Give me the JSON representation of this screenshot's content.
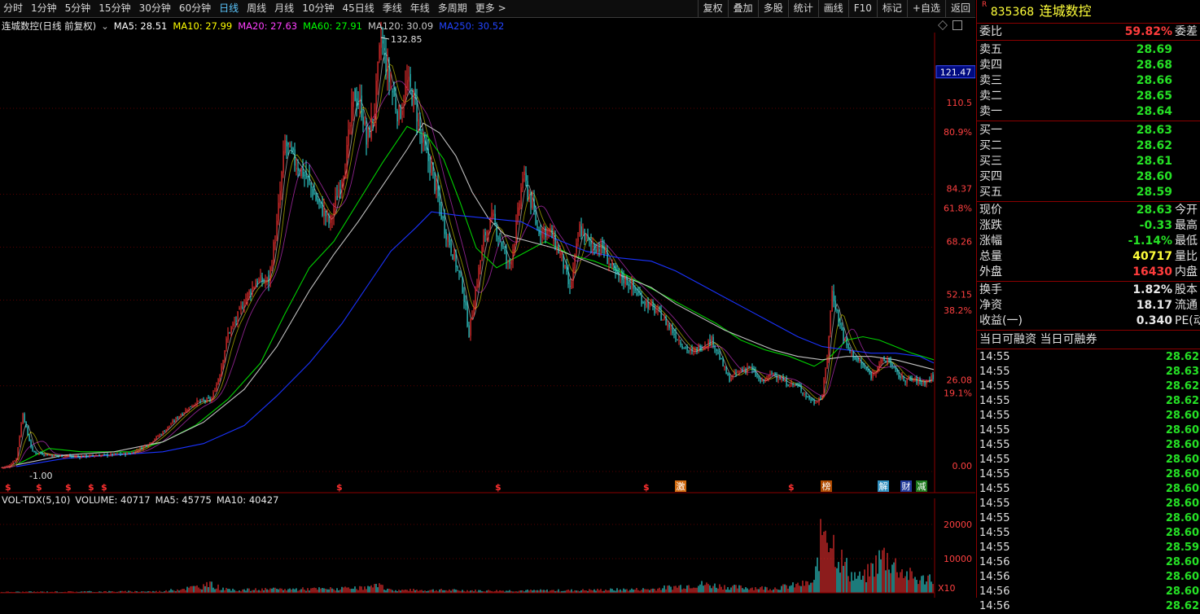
{
  "toolbar": {
    "periods": [
      "分时",
      "1分钟",
      "5分钟",
      "15分钟",
      "30分钟",
      "60分钟",
      "日线",
      "周线",
      "月线",
      "10分钟",
      "45日线",
      "季线",
      "年线",
      "多周期"
    ],
    "active_period": "日线",
    "more": "更多",
    "tools": [
      "复权",
      "叠加",
      "多股",
      "统计",
      "画线",
      "F10",
      "标记",
      "+自选",
      "返回"
    ]
  },
  "chart_data": {
    "type": "candlestick",
    "title": "连城数控(日线 前复权)",
    "indicators": [
      {
        "name": "MA5",
        "value": "28.51",
        "color": "#ffffff"
      },
      {
        "name": "MA10",
        "value": "27.99",
        "color": "#ffff00"
      },
      {
        "name": "MA20",
        "value": "27.63",
        "color": "#ff40ff"
      },
      {
        "name": "MA60",
        "value": "27.91",
        "color": "#00ff00"
      },
      {
        "name": "MA120",
        "value": "30.09",
        "color": "#c8c8c8"
      },
      {
        "name": "MA250",
        "value": "30.52",
        "color": "#2244ff"
      }
    ],
    "y_axis": {
      "ticks": [
        {
          "label": "110.5",
          "value": 110.5
        },
        {
          "label": "84.37",
          "value": 84.37
        },
        {
          "label": "68.26",
          "value": 68.26
        },
        {
          "label": "52.15",
          "value": 52.15
        },
        {
          "label": "26.08",
          "value": 26.08
        },
        {
          "label": "0.00",
          "value": 0.0
        }
      ],
      "pct_ticks": [
        {
          "label": "80.9%",
          "value": 104.5
        },
        {
          "label": "61.8%",
          "value": 81.4
        },
        {
          "label": "38.2%",
          "value": 50.3
        },
        {
          "label": "19.1%",
          "value": 25.1
        }
      ],
      "ylim": [
        -1,
        140
      ],
      "current_price_marker": {
        "label": "121.47",
        "value": 121.47
      }
    },
    "annotations": {
      "high": "132.85",
      "low": "1.00"
    },
    "price_path": [
      [
        0,
        1.2
      ],
      [
        10,
        1.5
      ],
      [
        20,
        4
      ],
      [
        28,
        18
      ],
      [
        33,
        12
      ],
      [
        40,
        6
      ],
      [
        60,
        5
      ],
      [
        90,
        4.5
      ],
      [
        130,
        5
      ],
      [
        160,
        5.5
      ],
      [
        180,
        8
      ],
      [
        200,
        12
      ],
      [
        220,
        17
      ],
      [
        240,
        21
      ],
      [
        260,
        22
      ],
      [
        270,
        30
      ],
      [
        280,
        42
      ],
      [
        290,
        46
      ],
      [
        300,
        52
      ],
      [
        315,
        58
      ],
      [
        330,
        58
      ],
      [
        340,
        75
      ],
      [
        350,
        100
      ],
      [
        360,
        95
      ],
      [
        375,
        90
      ],
      [
        390,
        82
      ],
      [
        400,
        78
      ],
      [
        405,
        75
      ],
      [
        415,
        85
      ],
      [
        425,
        95
      ],
      [
        435,
        115
      ],
      [
        445,
        110
      ],
      [
        450,
        100
      ],
      [
        460,
        110
      ],
      [
        468,
        132
      ],
      [
        475,
        122
      ],
      [
        490,
        108
      ],
      [
        500,
        118
      ],
      [
        510,
        112
      ],
      [
        518,
        100
      ],
      [
        530,
        92
      ],
      [
        545,
        75
      ],
      [
        558,
        65
      ],
      [
        568,
        56
      ],
      [
        576,
        42
      ],
      [
        584,
        55
      ],
      [
        595,
        72
      ],
      [
        605,
        77
      ],
      [
        615,
        70
      ],
      [
        625,
        62
      ],
      [
        633,
        72
      ],
      [
        642,
        90
      ],
      [
        650,
        84
      ],
      [
        660,
        74
      ],
      [
        675,
        73
      ],
      [
        690,
        65
      ],
      [
        700,
        55
      ],
      [
        712,
        74
      ],
      [
        725,
        69
      ],
      [
        740,
        68
      ],
      [
        755,
        60
      ],
      [
        770,
        58
      ],
      [
        790,
        52
      ],
      [
        810,
        48
      ],
      [
        825,
        43
      ],
      [
        840,
        38
      ],
      [
        850,
        36
      ],
      [
        860,
        38
      ],
      [
        875,
        40
      ],
      [
        885,
        34
      ],
      [
        895,
        28
      ],
      [
        905,
        30
      ],
      [
        920,
        32
      ],
      [
        935,
        27
      ],
      [
        950,
        30
      ],
      [
        965,
        27
      ],
      [
        980,
        26
      ],
      [
        990,
        23
      ],
      [
        1000,
        21
      ],
      [
        1010,
        23
      ],
      [
        1016,
        35
      ],
      [
        1022,
        55
      ],
      [
        1030,
        46
      ],
      [
        1040,
        38
      ],
      [
        1052,
        34
      ],
      [
        1060,
        32
      ],
      [
        1070,
        29
      ],
      [
        1080,
        33
      ],
      [
        1092,
        34
      ],
      [
        1100,
        30
      ],
      [
        1110,
        28
      ],
      [
        1120,
        28
      ],
      [
        1135,
        27
      ],
      [
        1147,
        29
      ]
    ],
    "ma_lines": [
      {
        "name": "MA60",
        "color": "#00d000",
        "points": [
          [
            20,
            2
          ],
          [
            60,
            7
          ],
          [
            100,
            6
          ],
          [
            160,
            6
          ],
          [
            200,
            9
          ],
          [
            240,
            14
          ],
          [
            280,
            22
          ],
          [
            320,
            33
          ],
          [
            350,
            48
          ],
          [
            380,
            62
          ],
          [
            410,
            70
          ],
          [
            440,
            82
          ],
          [
            470,
            94
          ],
          [
            500,
            105
          ],
          [
            525,
            102
          ],
          [
            545,
            95
          ],
          [
            565,
            82
          ],
          [
            585,
            68
          ],
          [
            610,
            62
          ],
          [
            640,
            66
          ],
          [
            670,
            70
          ],
          [
            700,
            66
          ],
          [
            730,
            64
          ],
          [
            760,
            61
          ],
          [
            790,
            57
          ],
          [
            820,
            53
          ],
          [
            850,
            49
          ],
          [
            880,
            45
          ],
          [
            910,
            40
          ],
          [
            940,
            37
          ],
          [
            970,
            35
          ],
          [
            1000,
            32
          ],
          [
            1020,
            35
          ],
          [
            1040,
            40
          ],
          [
            1060,
            41
          ],
          [
            1080,
            40
          ],
          [
            1100,
            38
          ],
          [
            1120,
            36
          ],
          [
            1147,
            34
          ]
        ]
      },
      {
        "name": "MA120",
        "color": "#c0c0c0",
        "points": [
          [
            20,
            2
          ],
          [
            80,
            5
          ],
          [
            140,
            6
          ],
          [
            200,
            9
          ],
          [
            250,
            15
          ],
          [
            300,
            25
          ],
          [
            340,
            38
          ],
          [
            380,
            55
          ],
          [
            410,
            66
          ],
          [
            440,
            76
          ],
          [
            470,
            87
          ],
          [
            500,
            98
          ],
          [
            520,
            106
          ],
          [
            540,
            103
          ],
          [
            560,
            96
          ],
          [
            580,
            85
          ],
          [
            600,
            77
          ],
          [
            620,
            72
          ],
          [
            650,
            70
          ],
          [
            680,
            68
          ],
          [
            710,
            65
          ],
          [
            740,
            62
          ],
          [
            770,
            59
          ],
          [
            800,
            56
          ],
          [
            830,
            51
          ],
          [
            860,
            47
          ],
          [
            890,
            43
          ],
          [
            920,
            40
          ],
          [
            950,
            37
          ],
          [
            980,
            35
          ],
          [
            1010,
            34
          ],
          [
            1040,
            35
          ],
          [
            1070,
            35
          ],
          [
            1100,
            34
          ],
          [
            1147,
            31
          ]
        ]
      },
      {
        "name": "MA250",
        "color": "#1a33ff",
        "points": [
          [
            20,
            1.5
          ],
          [
            80,
            4
          ],
          [
            140,
            5
          ],
          [
            200,
            6
          ],
          [
            250,
            8.5
          ],
          [
            300,
            14
          ],
          [
            340,
            23
          ],
          [
            380,
            33
          ],
          [
            420,
            45
          ],
          [
            450,
            56
          ],
          [
            480,
            67
          ],
          [
            510,
            74
          ],
          [
            530,
            79
          ],
          [
            560,
            78
          ],
          [
            600,
            77
          ],
          [
            640,
            76
          ],
          [
            680,
            71
          ],
          [
            720,
            67
          ],
          [
            760,
            65
          ],
          [
            800,
            64
          ],
          [
            830,
            61
          ],
          [
            860,
            57
          ],
          [
            890,
            53
          ],
          [
            920,
            49
          ],
          [
            950,
            45
          ],
          [
            980,
            41
          ],
          [
            1010,
            38
          ],
          [
            1040,
            37
          ],
          [
            1070,
            36
          ],
          [
            1100,
            36
          ],
          [
            1130,
            35
          ],
          [
            1147,
            33
          ]
        ]
      }
    ],
    "event_markers": [
      {
        "x": 6,
        "label": "$",
        "type": "dividend"
      },
      {
        "x": 44,
        "label": "$",
        "type": "dividend"
      },
      {
        "x": 80,
        "label": "$",
        "type": "dividend"
      },
      {
        "x": 108,
        "label": "$",
        "type": "dividend"
      },
      {
        "x": 124,
        "label": "$",
        "type": "dividend"
      },
      {
        "x": 413,
        "label": "$",
        "type": "dividend"
      },
      {
        "x": 608,
        "label": "$",
        "type": "dividend"
      },
      {
        "x": 790,
        "label": "$",
        "type": "dividend"
      },
      {
        "x": 835,
        "label": "激",
        "type": "notice"
      },
      {
        "x": 968,
        "label": "$",
        "type": "dividend"
      },
      {
        "x": 1014,
        "label": "榜",
        "type": "notice"
      },
      {
        "x": 1084,
        "label": "解",
        "type": "notice"
      },
      {
        "x": 1112,
        "label": "财",
        "type": "notice"
      },
      {
        "x": 1131,
        "label": "减",
        "type": "notice"
      }
    ],
    "volume": {
      "legend": {
        "name": "VOL-TDX(5,10)",
        "volume": "VOLUME: 40717",
        "ma5": "MA5: 45775",
        "ma10": "MA10: 40427"
      },
      "y_ticks": [
        {
          "label": "20000",
          "value": 20000
        },
        {
          "label": "10000",
          "value": 10000
        }
      ],
      "unit": "X10",
      "profile": [
        [
          0,
          300
        ],
        [
          100,
          400
        ],
        [
          200,
          500
        ],
        [
          260,
          2600
        ],
        [
          280,
          900
        ],
        [
          350,
          1200
        ],
        [
          440,
          1400
        ],
        [
          465,
          2200
        ],
        [
          480,
          900
        ],
        [
          540,
          900
        ],
        [
          600,
          700
        ],
        [
          700,
          800
        ],
        [
          800,
          1200
        ],
        [
          860,
          2800
        ],
        [
          900,
          1800
        ],
        [
          950,
          1500
        ],
        [
          1000,
          3200
        ],
        [
          1013,
          24000
        ],
        [
          1022,
          17000
        ],
        [
          1030,
          12000
        ],
        [
          1045,
          6000
        ],
        [
          1060,
          4500
        ],
        [
          1075,
          9000
        ],
        [
          1085,
          12000
        ],
        [
          1095,
          10000
        ],
        [
          1110,
          6500
        ],
        [
          1130,
          4000
        ],
        [
          1147,
          5500
        ]
      ]
    }
  },
  "panel": {
    "stock": {
      "r": "R",
      "code": "835368",
      "name": "连城数控"
    },
    "weibi": {
      "label": "委比",
      "value": "59.82%",
      "extra": "委差"
    },
    "asks": [
      {
        "label": "卖五",
        "price": "28.69"
      },
      {
        "label": "卖四",
        "price": "28.68"
      },
      {
        "label": "卖三",
        "price": "28.66"
      },
      {
        "label": "卖二",
        "price": "28.65"
      },
      {
        "label": "卖一",
        "price": "28.64"
      }
    ],
    "bids": [
      {
        "label": "买一",
        "price": "28.63"
      },
      {
        "label": "买二",
        "price": "28.62"
      },
      {
        "label": "买三",
        "price": "28.61"
      },
      {
        "label": "买四",
        "price": "28.60"
      },
      {
        "label": "买五",
        "price": "28.59"
      }
    ],
    "quote": [
      {
        "label": "现价",
        "value": "28.63",
        "color": "green",
        "extra": "今开"
      },
      {
        "label": "涨跌",
        "value": "-0.33",
        "color": "green",
        "extra": "最高"
      },
      {
        "label": "涨幅",
        "value": "-1.14%",
        "color": "green",
        "extra": "最低"
      },
      {
        "label": "总量",
        "value": "40717",
        "color": "yellow",
        "extra": "量比"
      },
      {
        "label": "外盘",
        "value": "16430",
        "color": "red",
        "extra": "内盘"
      }
    ],
    "stats": [
      {
        "label": "换手",
        "value": "1.82%",
        "extra": "股本"
      },
      {
        "label": "净资",
        "value": "18.17",
        "extra": "流通"
      },
      {
        "label": "收益(一)",
        "value": "0.340",
        "extra": "PE(动"
      }
    ],
    "rzrq": "当日可融资 当日可融券",
    "ticks": [
      {
        "time": "14:55",
        "price": "28.62"
      },
      {
        "time": "14:55",
        "price": "28.63"
      },
      {
        "time": "14:55",
        "price": "28.62"
      },
      {
        "time": "14:55",
        "price": "28.62"
      },
      {
        "time": "14:55",
        "price": "28.60"
      },
      {
        "time": "14:55",
        "price": "28.60"
      },
      {
        "time": "14:55",
        "price": "28.60"
      },
      {
        "time": "14:55",
        "price": "28.60"
      },
      {
        "time": "14:55",
        "price": "28.60"
      },
      {
        "time": "14:55",
        "price": "28.60"
      },
      {
        "time": "14:55",
        "price": "28.60"
      },
      {
        "time": "14:55",
        "price": "28.60"
      },
      {
        "time": "14:55",
        "price": "28.60"
      },
      {
        "time": "14:55",
        "price": "28.59"
      },
      {
        "time": "14:56",
        "price": "28.60"
      },
      {
        "time": "14:56",
        "price": "28.60"
      },
      {
        "time": "14:56",
        "price": "28.60"
      },
      {
        "time": "14:56",
        "price": "28.62"
      }
    ]
  }
}
